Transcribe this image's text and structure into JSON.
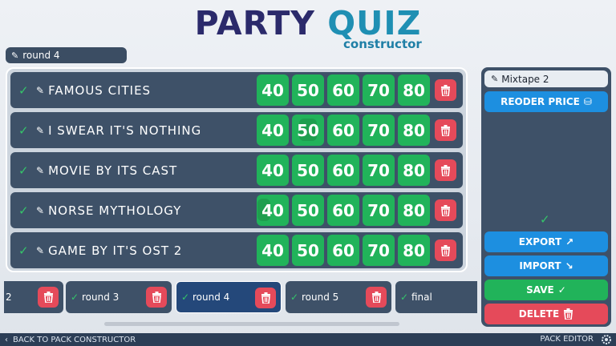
{
  "logo": {
    "part1": "PARTY ",
    "part2": "QUIZ",
    "sub": "constructor"
  },
  "round_name": "round 4",
  "categories": [
    {
      "name": "FAMOUS CITIES",
      "prices": [
        "40",
        "50",
        "60",
        "70",
        "80"
      ]
    },
    {
      "name": "I SWEAR IT'S NOTHING",
      "prices": [
        "40",
        "50",
        "60",
        "70",
        "80"
      ]
    },
    {
      "name": "MOVIE BY ITS CAST",
      "prices": [
        "40",
        "50",
        "60",
        "70",
        "80"
      ]
    },
    {
      "name": "NORSE MYTHOLOGY",
      "prices": [
        "40",
        "50",
        "60",
        "70",
        "80"
      ]
    },
    {
      "name": "GAME BY IT'S OST 2",
      "prices": [
        "40",
        "50",
        "60",
        "70",
        "80"
      ]
    }
  ],
  "tabs": [
    {
      "label": "2"
    },
    {
      "label": "round 3"
    },
    {
      "label": "round 4"
    },
    {
      "label": "round 5"
    },
    {
      "label": "final"
    }
  ],
  "side": {
    "pack_name": "Mixtape 2",
    "reorder_label": "REODER PRICE",
    "export_label": "EXPORT",
    "import_label": "IMPORT",
    "save_label": "SAVE",
    "delete_label": "DELETE"
  },
  "footer": {
    "back_label": "BACK TO PACK CONSTRUCTOR",
    "pack_editor_label": "PACK EDITOR"
  },
  "colors": {
    "green": "#21b35a",
    "red": "#e54a5a",
    "blue": "#1d8fe0",
    "panel": "#3e5168"
  }
}
